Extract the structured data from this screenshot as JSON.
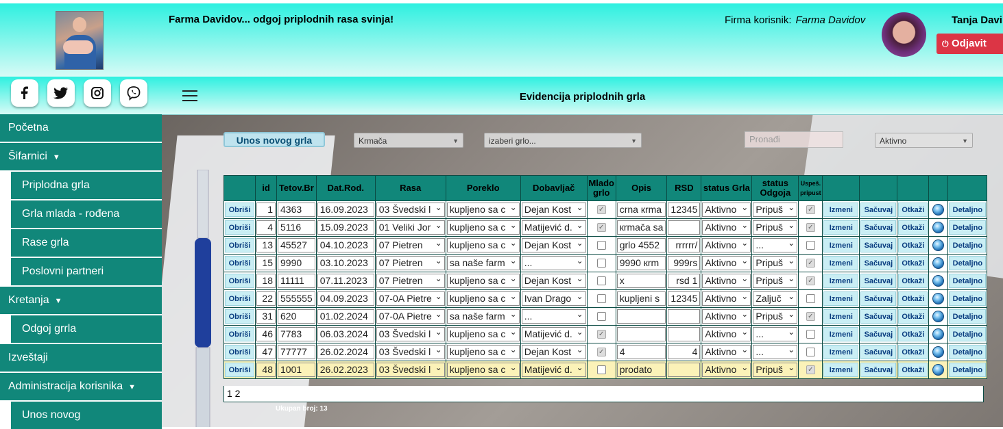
{
  "header": {
    "tagline": "Farma Davidov... odgoj priplodnih rasa svinja!",
    "firm_label": "Firma korisnik:",
    "firm_name": "Farma Davidov",
    "user_name": "Tanja Davi",
    "logout": "Odjavit"
  },
  "social": [
    "facebook-icon",
    "twitter-icon",
    "instagram-icon",
    "viber-icon"
  ],
  "sidebar": {
    "items": [
      {
        "label": "Početna",
        "type": "top"
      },
      {
        "label": "Šifarnici",
        "type": "top",
        "caret": "▼"
      },
      {
        "label": "Priplodna grla",
        "type": "sub"
      },
      {
        "label": "Grla mlada - rođena",
        "type": "sub"
      },
      {
        "label": "Rase grla",
        "type": "sub"
      },
      {
        "label": "Poslovni partneri",
        "type": "sub"
      },
      {
        "label": "Kretanja",
        "type": "top",
        "caret": "▼"
      },
      {
        "label": "Odgoj grrla",
        "type": "sub"
      },
      {
        "label": "Izveštaji",
        "type": "top"
      },
      {
        "label": "Administracija korisnika",
        "type": "top",
        "caret": "▼"
      },
      {
        "label": "Unos novog",
        "type": "sub"
      }
    ]
  },
  "page": {
    "title": "Evidencija priplodnih grla"
  },
  "toolbar": {
    "new_button": "Unos novog grla",
    "type_select": "Krmača",
    "animal_select": "izaberi grlo...",
    "search_placeholder": "Pronađi",
    "status_select": "Aktivno"
  },
  "table": {
    "headers": [
      "",
      "id",
      "Tetov.Br",
      "Dat.Rod.",
      "Rasa",
      "Poreklo",
      "Dobavljač",
      "Mlado grlo",
      "Opis",
      "RSD",
      "status Grla",
      "status Odgoja",
      "Uspeš. pripust",
      "",
      "",
      "",
      "",
      ""
    ],
    "delete_label": "Obriši",
    "edit_label": "Izmeni",
    "save_label": "Sačuvaj",
    "cancel_label": "Otkaži",
    "detail_label": "Detaljno",
    "rows": [
      {
        "id": "1",
        "tetov": "4363",
        "datum": "16.09.2023",
        "rasa": "03 Švedski l",
        "poreklo": "kupljeno sa c",
        "dobavljac": "Dejan Kost",
        "mlado": true,
        "opis": "crna кrma",
        "rsd": "12345",
        "status": "Aktivno",
        "odgoj": "Pripuš",
        "uspesan": true,
        "highlight": false
      },
      {
        "id": "4",
        "tetov": "5116",
        "datum": "15.09.2023",
        "rasa": "01 Veliki Jor",
        "poreklo": "kupljeno sa c",
        "dobavljac": "Matijević d.",
        "mlado": true,
        "opis": "кrmača sa",
        "rsd": "",
        "status": "Aktivno",
        "odgoj": "Pripuš",
        "uspesan": true,
        "highlight": false
      },
      {
        "id": "13",
        "tetov": "45527",
        "datum": "04.10.2023",
        "rasa": "07 Pietren",
        "poreklo": "kupljeno sa c",
        "dobavljac": "Dejan Kost",
        "mlado": false,
        "opis": "grlo 4552",
        "rsd": "rrrrrr/",
        "status": "Aktivno",
        "odgoj": "...",
        "uspesan": false,
        "highlight": false
      },
      {
        "id": "15",
        "tetov": "9990",
        "datum": "03.10.2023",
        "rasa": "07 Pietren",
        "poreklo": "sa naše farm",
        "dobavljac": "...",
        "mlado": false,
        "opis": "9990 кrm",
        "rsd": "999rs",
        "status": "Aktivno",
        "odgoj": "Pripuš",
        "uspesan": true,
        "highlight": false
      },
      {
        "id": "18",
        "tetov": "11111",
        "datum": "07.11.2023",
        "rasa": "07 Pietren",
        "poreklo": "kupljeno sa c",
        "dobavljac": "Dejan Kost",
        "mlado": false,
        "opis": "x",
        "rsd": "rsd 1",
        "status": "Aktivno",
        "odgoj": "Pripuš",
        "uspesan": true,
        "highlight": false
      },
      {
        "id": "22",
        "tetov": "555555",
        "datum": "04.09.2023",
        "rasa": "07-0A Pietre",
        "poreklo": "kupljeno sa c",
        "dobavljac": "Ivan Drago",
        "mlado": false,
        "opis": "kupljeni s",
        "rsd": "12345",
        "status": "Aktivno",
        "odgoj": "Zaljuč",
        "uspesan": false,
        "highlight": false
      },
      {
        "id": "31",
        "tetov": "620",
        "datum": "01.02.2024",
        "rasa": "07-0A Pietre",
        "poreklo": "sa naše farm",
        "dobavljac": "...",
        "mlado": false,
        "opis": "",
        "rsd": "",
        "status": "Aktivno",
        "odgoj": "Pripuš",
        "uspesan": true,
        "highlight": false
      },
      {
        "id": "46",
        "tetov": "7783",
        "datum": "06.03.2024",
        "rasa": "03 Švedski l",
        "poreklo": "kupljeno sa c",
        "dobavljac": "Matijević d.",
        "mlado": true,
        "opis": "",
        "rsd": "",
        "status": "Aktivno",
        "odgoj": "...",
        "uspesan": false,
        "highlight": false
      },
      {
        "id": "47",
        "tetov": "77777",
        "datum": "26.02.2024",
        "rasa": "03 Švedski l",
        "poreklo": "kupljeno sa c",
        "dobavljac": "Dejan Kost",
        "mlado": true,
        "opis": "4",
        "rsd": "4",
        "status": "Aktivno",
        "odgoj": "...",
        "uspesan": false,
        "highlight": false
      },
      {
        "id": "48",
        "tetov": "1001",
        "datum": "26.02.2023",
        "rasa": "03 Švedski l",
        "poreklo": "kupljeno sa c",
        "dobavljac": "Matijević d.",
        "mlado": false,
        "opis": "prodato",
        "rsd": "",
        "status": "Aktivno",
        "odgoj": "Pripuš",
        "uspesan": true,
        "highlight": true
      }
    ],
    "pager": "1 2",
    "total": "Ukupan broj: 13"
  }
}
